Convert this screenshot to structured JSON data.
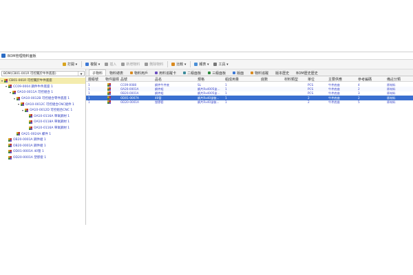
{
  "window": {
    "title": "BOM管理物料面板"
  },
  "toolbar": {
    "buttons": [
      {
        "label": "打開 ▾",
        "icon": "folder-icon",
        "color": "#d9a520",
        "disabled": false
      },
      {
        "label": "複製 ▾",
        "icon": "copy-icon",
        "color": "#3b78d6",
        "disabled": false
      },
      {
        "label": "插入",
        "icon": "insert-icon",
        "color": "#9a9a9a",
        "disabled": true
      },
      {
        "label": "新增物料",
        "icon": "add-icon",
        "color": "#9a9a9a",
        "disabled": true
      },
      {
        "label": "刪除物料",
        "icon": "delete-icon",
        "color": "#9a9a9a",
        "disabled": true
      },
      {
        "label": "比較 ▾",
        "icon": "compare-icon",
        "color": "#d98a20",
        "disabled": false
      },
      {
        "label": "報表 ▾",
        "icon": "report-icon",
        "color": "#4a8fd6",
        "disabled": false
      },
      {
        "label": "工具 ▾",
        "icon": "tools-icon",
        "color": "#777777",
        "disabled": false
      }
    ]
  },
  "left_panel": {
    "combo_value": "BOM(CB01-001R 可控關於牛件底座)",
    "tree": [
      {
        "label": "CB01-001R 可控關於牛件底座",
        "level": 0,
        "expanded": true,
        "selected": true
      },
      {
        "label": "CC09-0004 鋼件牛件底座 1",
        "level": 1,
        "expanded": true,
        "selected": false
      },
      {
        "label": "OA10-0011A 可控組合 1",
        "level": 2,
        "expanded": true,
        "selected": false
      },
      {
        "label": "OA10-0012B 可控組合零件底座 1",
        "level": 3,
        "expanded": true,
        "selected": false
      },
      {
        "label": "OA10-0012C 可控組合CNC組件 1",
        "level": 4,
        "expanded": true,
        "selected": false
      },
      {
        "label": "OA10-0012D 可控組合CNC 1",
        "level": 5,
        "expanded": true,
        "selected": false
      },
      {
        "label": "OA10-0116A 單氧鋼材 1",
        "level": 6,
        "expanded": false,
        "selected": false
      },
      {
        "label": "OA10-0118A 單氧鋼材 1",
        "level": 6,
        "expanded": false,
        "selected": false
      },
      {
        "label": "OA10-0116A 單氧鋼材 1",
        "level": 6,
        "expanded": false,
        "selected": false
      },
      {
        "label": "OA21-0024A 螺件 1",
        "level": 3,
        "expanded": false,
        "selected": false
      },
      {
        "label": "OB20-0001A 鋼件組 1",
        "level": 1,
        "expanded": false,
        "selected": false
      },
      {
        "label": "OB20-0001A 鋼件組 1",
        "level": 1,
        "expanded": false,
        "selected": false
      },
      {
        "label": "OD01-0001A 40管 1",
        "level": 1,
        "expanded": false,
        "selected": false
      },
      {
        "label": "OD20-0001A 塑膠套 1",
        "level": 1,
        "expanded": false,
        "selected": false
      }
    ]
  },
  "tabs": [
    {
      "label": "子物料",
      "active": true,
      "icon": ""
    },
    {
      "label": "物料總表",
      "active": false,
      "icon": ""
    },
    {
      "label": "物料用戶",
      "active": false,
      "icon": "user-icon"
    },
    {
      "label": "用料追蹤卡",
      "active": false,
      "icon": "track-icon"
    },
    {
      "label": "二級面板",
      "active": false,
      "icon": "panel-icon"
    },
    {
      "label": "三級面板",
      "active": false,
      "icon": "panel-icon"
    },
    {
      "label": "版面",
      "active": false,
      "icon": "layout-icon"
    },
    {
      "label": "物料追蹤",
      "active": false,
      "icon": "trace-icon"
    },
    {
      "label": "版本歷史",
      "active": false,
      "icon": ""
    },
    {
      "label": "BOM歷史歷史",
      "active": false,
      "icon": ""
    }
  ],
  "table": {
    "columns": [
      "層級號",
      "物件圖標",
      "品號",
      "品名",
      "規格",
      "組成用量",
      "底數",
      "材料類型",
      "單位",
      "主要供應",
      "參考編碼",
      "備註分類"
    ],
    "rows": [
      {
        "level": "1",
        "code": "CC09-0080",
        "name": "鋼件牛件底",
        "spec": "SL",
        "qty": "1",
        "base": "",
        "mtype": "",
        "unit": "PCS",
        "supply": "牛件底座",
        "ref": "4",
        "note": "原材料"
      },
      {
        "level": "1",
        "code": "OA20-0001A",
        "name": "鋼件組",
        "spec": "鋼片Rx4005塗...",
        "qty": "1",
        "base": "",
        "mtype": "",
        "unit": "PCS",
        "supply": "牛件底座",
        "ref": "2",
        "note": "原材料"
      },
      {
        "level": "1",
        "code": "OB20-0001A",
        "name": "鋼件組",
        "spec": "鋼片Rx4005塗...",
        "qty": "1",
        "base": "",
        "mtype": "",
        "unit": "PCS",
        "supply": "牛件底座",
        "ref": "3",
        "note": "原材料"
      },
      {
        "level": "1",
        "code": "OD01-0007A",
        "name": "40管",
        "spec": "鋼片Rx40塗裝...",
        "qty": "1",
        "base": "",
        "mtype": "",
        "unit": "2",
        "supply": "牛件底座",
        "ref": "2",
        "note": "原材料"
      },
      {
        "level": "1",
        "code": "OD20-0001A",
        "name": "塑膠套",
        "spec": "鋼片Rx40塗裝...",
        "qty": "1",
        "base": "",
        "mtype": "",
        "unit": "2",
        "supply": "牛件底座",
        "ref": "5",
        "note": "原材料"
      }
    ],
    "selected_row": 3
  },
  "colors": {
    "accent": "#3a6fd0",
    "selected_tree": "#f4ecae",
    "link_text": "#3844c8"
  }
}
